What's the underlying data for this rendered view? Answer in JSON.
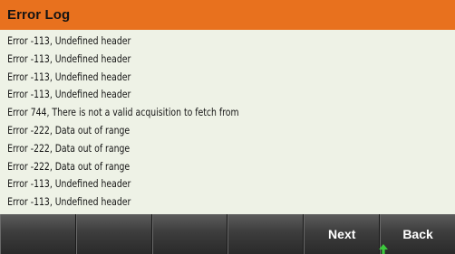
{
  "header": {
    "title": "Error Log"
  },
  "log": {
    "entries": [
      "Error -113, Undefined header",
      "Error -113, Undefined header",
      "Error -113, Undefined header",
      "Error -113, Undefined header",
      "Error 744, There is not a valid acquisition to fetch from",
      "Error -222, Data out of range",
      "Error -222, Data out of range",
      "Error -222, Data out of range",
      "Error -113, Undefined header",
      "Error -113, Undefined header"
    ]
  },
  "softkeys": [
    {
      "label": ""
    },
    {
      "label": ""
    },
    {
      "label": ""
    },
    {
      "label": ""
    },
    {
      "label": "Next"
    },
    {
      "label": "Back"
    }
  ],
  "icons": {
    "back_indicator": "up-arrow-icon"
  },
  "colors": {
    "title_bar": "#e8711e",
    "list_background": "#eef2e6",
    "softkey_background": "#3d3d3d",
    "indicator_arrow": "#3cc83c"
  }
}
